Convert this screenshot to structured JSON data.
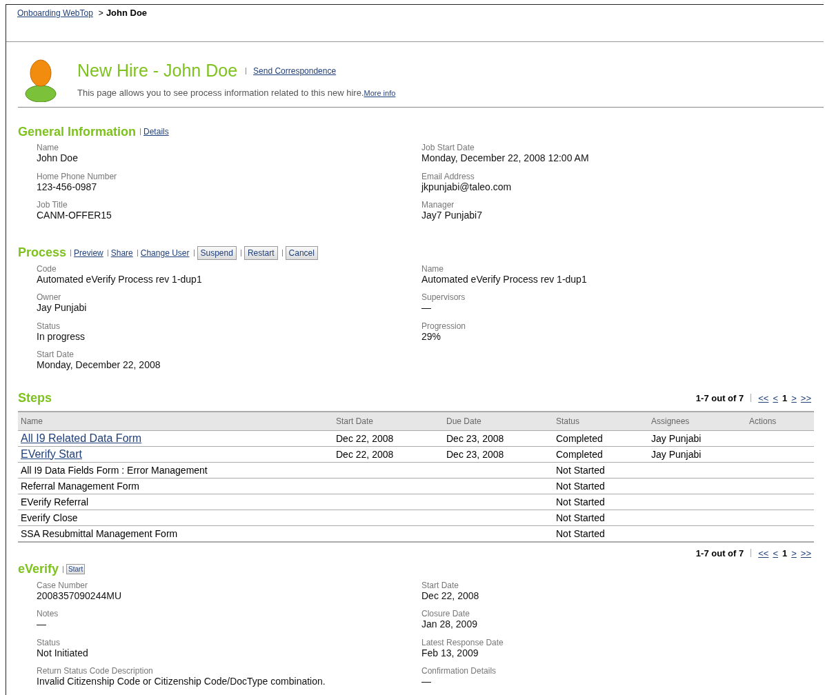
{
  "breadcrumb": {
    "link": "Onboarding WebTop",
    "separator": ">",
    "current": "John Doe"
  },
  "header": {
    "title": "New Hire - John Doe",
    "action_link": "Send Correspondence",
    "description": "This page allows you to see process information related to this new hire.",
    "more_info": "More info"
  },
  "general": {
    "title": "General Information",
    "actions": [
      {
        "kind": "link",
        "label": "Details"
      }
    ],
    "columns": [
      [
        {
          "label": "Name",
          "value": "John Doe"
        },
        {
          "label": "Home Phone Number",
          "value": "123-456-0987"
        },
        {
          "label": "Job Title",
          "value": "CANM-OFFER15"
        }
      ],
      [
        {
          "label": "Job Start Date",
          "value": "Monday, December 22, 2008 12:00 AM"
        },
        {
          "label": "Email Address",
          "value": "jkpunjabi@taleo.com"
        },
        {
          "label": "Manager",
          "value": "Jay7 Punjabi7"
        }
      ]
    ]
  },
  "process": {
    "title": "Process",
    "actions": [
      {
        "kind": "link",
        "label": "Preview"
      },
      {
        "kind": "link",
        "label": "Share"
      },
      {
        "kind": "link",
        "label": "Change User"
      },
      {
        "kind": "button",
        "label": "Suspend"
      },
      {
        "kind": "button",
        "label": "Restart"
      },
      {
        "kind": "button",
        "label": "Cancel"
      }
    ],
    "columns": [
      [
        {
          "label": "Code",
          "value": "Automated eVerify Process rev 1-dup1"
        },
        {
          "label": "Owner",
          "value": "Jay Punjabi"
        },
        {
          "label": "Status",
          "value": "In progress"
        },
        {
          "label": "Start Date",
          "value": "Monday, December 22, 2008"
        }
      ],
      [
        {
          "label": "Name",
          "value": "Automated eVerify Process rev 1-dup1"
        },
        {
          "label": "Supervisors",
          "value": "—"
        },
        {
          "label": "Progression",
          "value": "29%"
        }
      ]
    ]
  },
  "steps": {
    "title": "Steps",
    "pager_top": {
      "range": "1-7 out of 7",
      "first": "<<",
      "prev": "<",
      "page": "1",
      "next": ">",
      "last": ">>"
    },
    "columns": [
      "Name",
      "Start Date",
      "Due Date",
      "Status",
      "Assignees",
      "Actions"
    ],
    "rows": [
      {
        "kind": "link",
        "cells": [
          "All I9 Related Data Form",
          "Dec 22, 2008",
          "Dec 23, 2008",
          "Completed",
          "Jay Punjabi"
        ]
      },
      {
        "kind": "link",
        "cells": [
          "EVerify Start",
          "Dec 22, 2008",
          "Dec 23, 2008",
          "Completed",
          "Jay Punjabi"
        ]
      },
      {
        "kind": "plain",
        "cells": [
          "All I9 Data Fields Form : Error Management",
          "",
          "",
          "Not Started",
          ""
        ]
      },
      {
        "kind": "plain",
        "cells": [
          "Referral Management Form",
          "",
          "",
          "Not Started",
          ""
        ]
      },
      {
        "kind": "plain",
        "cells": [
          "EVerify Referral",
          "",
          "",
          "Not Started",
          ""
        ]
      },
      {
        "kind": "plain",
        "cells": [
          "Everify Close",
          "",
          "",
          "Not Started",
          ""
        ]
      },
      {
        "kind": "plain",
        "cells": [
          "SSA Resubmittal Management Form",
          "",
          "",
          "Not Started",
          ""
        ]
      }
    ],
    "pager_bottom": {
      "range": "1-7 out of 7",
      "first": "<<",
      "prev": "<",
      "page": "1",
      "next": ">",
      "last": ">>"
    }
  },
  "everify": {
    "title": "eVerify",
    "actions": [
      {
        "kind": "small-button",
        "label": "Start"
      }
    ],
    "columns": [
      [
        {
          "label": "Case Number",
          "value": "2008357090244MU"
        },
        {
          "label": "Notes",
          "value": "—"
        },
        {
          "label": "Status",
          "value": "Not Initiated"
        },
        {
          "label": "Return Status Code Description",
          "value": "Invalid Citizenship Code or Citizenship Code/DocType combination."
        }
      ],
      [
        {
          "label": "Start Date",
          "value": "Dec 22, 2008"
        },
        {
          "label": "Closure Date",
          "value": "Jan 28, 2009"
        },
        {
          "label": "Latest Response Date",
          "value": "Feb 13, 2009"
        },
        {
          "label": "Confirmation Details",
          "value": "—"
        }
      ]
    ]
  }
}
